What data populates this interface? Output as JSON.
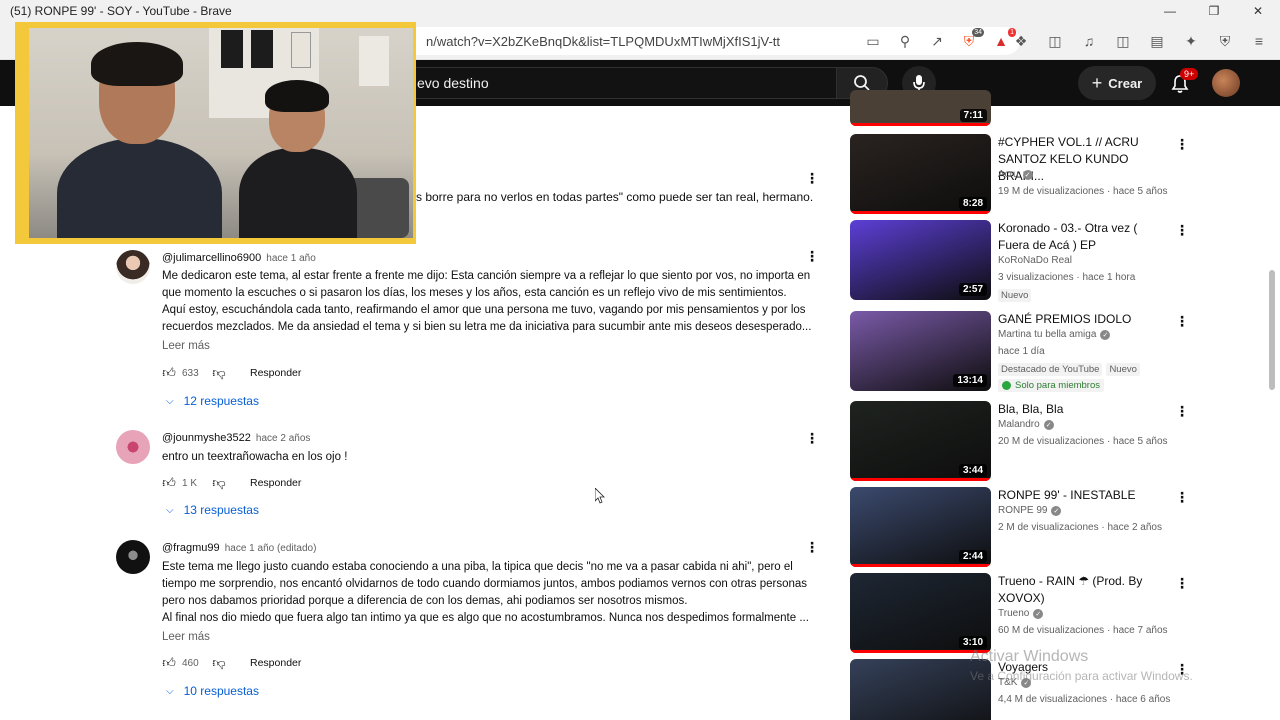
{
  "window": {
    "title": "(51) RONPE 99' - SOY - YouTube - Brave"
  },
  "browser": {
    "url": "n/watch?v=X2bZKeBnqDk&list=TLPQMDUxMTIwMjXfIS1jV-ttK...",
    "brave_shield_count": "34",
    "rewards_count": "1"
  },
  "youtube_header": {
    "search_value": "evo destino",
    "create_label": "Crear",
    "notification_count": "9+"
  },
  "comments": {
    "partial_line": "s borre para no verlos en todas partes\" como puede ser tan real, hermano.",
    "items": [
      {
        "author": "@julimarcellino6900",
        "when": "hace 1 año",
        "lines": [
          "Me dedicaron este tema, al estar frente a frente me dijo: Esta canción siempre va a reflejar lo que siento por vos, no importa en",
          "que momento la escuches o si pasaron los días, los meses y los años, esta canción es un reflejo vivo de mis sentimientos.",
          "Aquí estoy, escuchándola cada tanto, reafirmando el amor que una persona me tuvo, vagando por mis pensamientos y por los",
          "recuerdos mezclados. Me da ansiedad el tema y si bien su letra me da iniciativa para sucumbir ante mis deseos desesperado..."
        ],
        "more": "Leer más",
        "likes": "633",
        "reply": "Responder",
        "replies": "12 respuestas"
      },
      {
        "author": "@jounmyshe3522",
        "when": "hace 2 años",
        "lines": [
          "entro un teextrañowacha en los ojo !"
        ],
        "likes": "1 K",
        "reply": "Responder",
        "replies": "13 respuestas"
      },
      {
        "author": "@fragmu99",
        "when": "hace 1 año (editado)",
        "lines": [
          "Este tema me llego justo cuando estaba conociendo a una piba, la tipica que decis \"no me va a pasar cabida ni ahi\", pero el",
          "tiempo me sorprendio, nos encantó olvidarnos de todo cuando dormiamos juntos, ambos podiamos vernos con otras personas",
          "pero nos dabamos prioridad porque a diferencia de con los demas, ahi podiamos ser nosotros mismos.",
          "Al final nos dio miedo que fuera algo tan intimo ya que es algo que no acostumbramos. Nunca nos despedimos formalmente ..."
        ],
        "more": "Leer más",
        "likes": "460",
        "reply": "Responder",
        "replies": "10 respuestas"
      }
    ]
  },
  "sidebar": {
    "top_duration": "7:11",
    "videos": [
      {
        "title": "#CYPHER VOL.1 // ACRU SANTOZ KELO KUNDO BRAPI...",
        "channel": "Acru",
        "verified": true,
        "meta": "19 M de visualizaciones · hace 5 años",
        "duration": "8:28",
        "progress": 1.0,
        "colors": "#2a2320"
      },
      {
        "title": "Koronado - 03.- Otra vez ( Fuera de Acá ) EP",
        "channel": "KoRoNaDo Real",
        "verified": false,
        "meta": "3 visualizaciones · hace 1 hora",
        "badge": "Nuevo",
        "duration": "2:57",
        "progress": 0,
        "colors": "#5c3fd6"
      },
      {
        "title": "GANÉ PREMIOS IDOLO",
        "channel": "Martina tu bella amiga",
        "verified": true,
        "meta": "hace 1 día",
        "badge": "Destacado de YouTube",
        "badge2": "Nuevo",
        "member": "Solo para miembros",
        "duration": "13:14",
        "progress": 0,
        "colors": "#7a5aa8"
      },
      {
        "title": "Bla, Bla, Bla",
        "channel": "Malandro",
        "verified": true,
        "meta": "20 M de visualizaciones · hace 5 años",
        "duration": "3:44",
        "progress": 1.0,
        "colors": "#1f2320"
      },
      {
        "title": "RONPE 99' - INESTABLE",
        "channel": "RONPE 99",
        "verified": true,
        "meta": "2 M de visualizaciones · hace 2 años",
        "duration": "2:44",
        "progress": 1.0,
        "colors": "#3b4a6e"
      },
      {
        "title": "Trueno - RAIN ☂ (Prod. By XOVOX)",
        "channel": "Trueno",
        "verified": true,
        "meta": "60 M de visualizaciones · hace 7 años",
        "duration": "3:10",
        "progress": 1.0,
        "colors": "#1e2734"
      },
      {
        "title": "Voyagers",
        "channel": "T&K",
        "verified": true,
        "meta": "4,4 M de visualizaciones · hace 6 años",
        "duration": "",
        "progress": 0,
        "colors": "#35415a"
      }
    ]
  },
  "watermark": {
    "line1": "Activar Windows",
    "line2": "Ve a Configuración para activar Windows."
  }
}
